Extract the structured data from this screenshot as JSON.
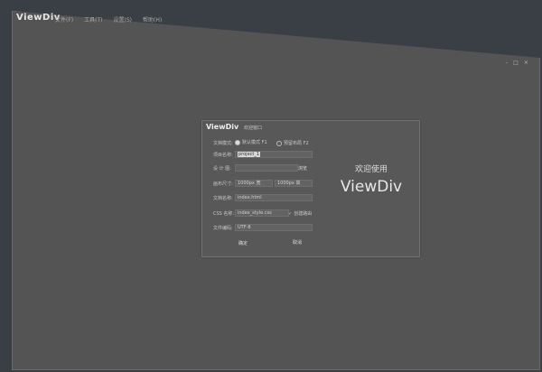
{
  "app": {
    "title": "ViewDiv"
  },
  "menu": [
    "文件(F)",
    "工具(T)",
    "设置(S)",
    "帮助(H)"
  ],
  "window_controls": [
    "-",
    "□",
    "×"
  ],
  "dialog": {
    "title": "ViewDiv",
    "subtitle": "欢迎窗口",
    "doc_mode_label": "文档模式:",
    "mode_default": "默认模式 F1",
    "mode_other": "预留布局 F2",
    "project_label": "项目名称:",
    "project_value": "project_1",
    "design_label": "设 计 图:",
    "design_browse": "浏览",
    "canvas_label": "画布尺寸:",
    "canvas_width": "1000px 宽",
    "canvas_height": "1000px 高",
    "docname_label": "文档名称:",
    "docname_value": "index.html",
    "css_label": "CSS 名称:",
    "css_value": "index_style.css",
    "css_check": "创建路由",
    "encoding_label": "文件编码:",
    "encoding_value": "UTF-8",
    "ok": "确定",
    "cancel": "取消",
    "welcome_line1": "欢迎使用",
    "welcome_line2": "ViewDiv"
  }
}
